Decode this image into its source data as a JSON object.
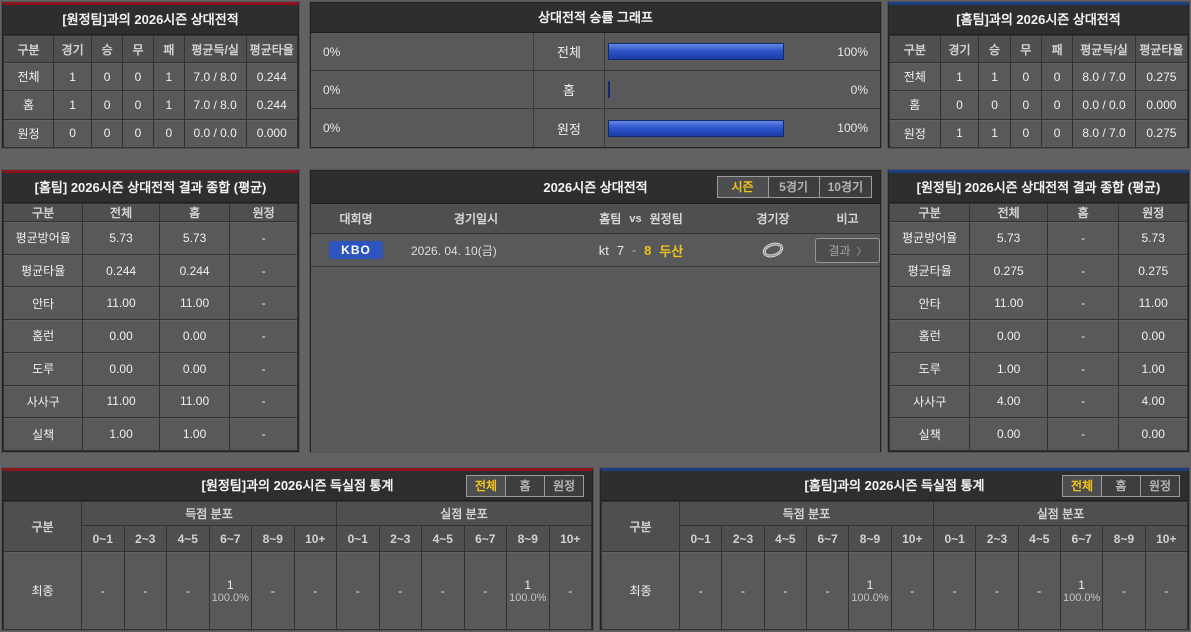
{
  "colors": {
    "accent_red": "#8d141f",
    "accent_blue": "#1c3e7e",
    "highlight_yellow": "#f0c419",
    "badge_blue": "#2d55bd",
    "bar_blue": "#2f55cc"
  },
  "top_left": {
    "title": "[원정팀]과의 2026시즌 상대전적",
    "headers": [
      "구분",
      "경기",
      "승",
      "무",
      "패",
      "평균득/실",
      "평균타율"
    ],
    "rows": [
      {
        "label": "전체",
        "values": [
          "1",
          "0",
          "0",
          "1",
          "7.0 / 8.0",
          "0.244"
        ]
      },
      {
        "label": "홈",
        "values": [
          "1",
          "0",
          "0",
          "1",
          "7.0 / 8.0",
          "0.244"
        ]
      },
      {
        "label": "원정",
        "values": [
          "0",
          "0",
          "0",
          "0",
          "0.0 / 0.0",
          "0.000"
        ]
      }
    ]
  },
  "graph": {
    "title": "상대전적 승률 그래프",
    "chart_data": {
      "type": "bar",
      "categories": [
        "전체",
        "홈",
        "원정"
      ],
      "series": [
        {
          "name": "left_win_rate",
          "values": [
            0,
            0,
            0
          ]
        },
        {
          "name": "right_win_rate",
          "values": [
            100,
            0,
            100
          ]
        }
      ],
      "xlim": [
        0,
        100
      ],
      "legend_position": "none"
    },
    "rows": [
      {
        "label": "전체",
        "left_pct": "0%",
        "right_pct": "100%",
        "left_val": 0,
        "right_val": 100
      },
      {
        "label": "홈",
        "left_pct": "0%",
        "right_pct": "0%",
        "left_val": 0,
        "right_val": 0
      },
      {
        "label": "원정",
        "left_pct": "0%",
        "right_pct": "100%",
        "left_val": 0,
        "right_val": 100
      }
    ]
  },
  "top_right": {
    "title": "[홈팀]과의 2026시즌 상대전적",
    "headers": [
      "구분",
      "경기",
      "승",
      "무",
      "패",
      "평균득/실",
      "평균타율"
    ],
    "rows": [
      {
        "label": "전체",
        "values": [
          "1",
          "1",
          "0",
          "0",
          "8.0 / 7.0",
          "0.275"
        ]
      },
      {
        "label": "홈",
        "values": [
          "0",
          "0",
          "0",
          "0",
          "0.0 / 0.0",
          "0.000"
        ]
      },
      {
        "label": "원정",
        "values": [
          "1",
          "1",
          "0",
          "0",
          "8.0 / 7.0",
          "0.275"
        ]
      }
    ]
  },
  "mid_left": {
    "title": "[홈팀] 2026시즌 상대전적 결과 종합 (평균)",
    "headers": [
      "구분",
      "전체",
      "홈",
      "원정"
    ],
    "rows": [
      {
        "label": "평균방어율",
        "values": [
          "5.73",
          "5.73",
          "-"
        ]
      },
      {
        "label": "평균타율",
        "values": [
          "0.244",
          "0.244",
          "-"
        ]
      },
      {
        "label": "안타",
        "values": [
          "11.00",
          "11.00",
          "-"
        ]
      },
      {
        "label": "홈런",
        "values": [
          "0.00",
          "0.00",
          "-"
        ]
      },
      {
        "label": "도루",
        "values": [
          "0.00",
          "0.00",
          "-"
        ]
      },
      {
        "label": "사사구",
        "values": [
          "11.00",
          "11.00",
          "-"
        ]
      },
      {
        "label": "실책",
        "values": [
          "1.00",
          "1.00",
          "-"
        ]
      }
    ]
  },
  "match": {
    "title": "2026시즌 상대전적",
    "tabs": [
      {
        "label": "시즌",
        "active": true
      },
      {
        "label": "5경기",
        "active": false
      },
      {
        "label": "10경기",
        "active": false
      }
    ],
    "headers": {
      "league": "대회명",
      "datetime": "경기일시",
      "home": "홈팀",
      "vs": "vs",
      "away": "원정팀",
      "stadium": "경기장",
      "note": "비고"
    },
    "row": {
      "league": "KBO",
      "datetime": "2026. 04. 10(금)",
      "home_team": "kt",
      "home_score": "7",
      "separator": "-",
      "away_score": "8",
      "away_team": "두산",
      "result_label": "결과",
      "result_arrow": "〉"
    }
  },
  "mid_right": {
    "title": "[원정팀] 2026시즌 상대전적 결과 종합 (평균)",
    "headers": [
      "구분",
      "전체",
      "홈",
      "원정"
    ],
    "rows": [
      {
        "label": "평균방어율",
        "values": [
          "5.73",
          "-",
          "5.73"
        ]
      },
      {
        "label": "평균타율",
        "values": [
          "0.275",
          "-",
          "0.275"
        ]
      },
      {
        "label": "안타",
        "values": [
          "11.00",
          "-",
          "11.00"
        ]
      },
      {
        "label": "홈런",
        "values": [
          "0.00",
          "-",
          "0.00"
        ]
      },
      {
        "label": "도루",
        "values": [
          "1.00",
          "-",
          "1.00"
        ]
      },
      {
        "label": "사사구",
        "values": [
          "4.00",
          "-",
          "4.00"
        ]
      },
      {
        "label": "실책",
        "values": [
          "0.00",
          "-",
          "0.00"
        ]
      }
    ]
  },
  "bottom_left": {
    "title": "[원정팀]과의 2026시즌 득실점 통계",
    "tabs": [
      {
        "label": "전체",
        "active": true
      },
      {
        "label": "홈",
        "active": false
      },
      {
        "label": "원정",
        "active": false
      }
    ],
    "group_col": "구분",
    "scored_group": "득점 분포",
    "conceded_group": "실점 분포",
    "bins": [
      "0~1",
      "2~3",
      "4~5",
      "6~7",
      "8~9",
      "10+"
    ],
    "row_label": "최종",
    "scored": [
      {
        "count": "-",
        "pct": ""
      },
      {
        "count": "-",
        "pct": ""
      },
      {
        "count": "-",
        "pct": ""
      },
      {
        "count": "1",
        "pct": "100.0%"
      },
      {
        "count": "-",
        "pct": ""
      },
      {
        "count": "-",
        "pct": ""
      }
    ],
    "conceded": [
      {
        "count": "-",
        "pct": ""
      },
      {
        "count": "-",
        "pct": ""
      },
      {
        "count": "-",
        "pct": ""
      },
      {
        "count": "-",
        "pct": ""
      },
      {
        "count": "1",
        "pct": "100.0%"
      },
      {
        "count": "-",
        "pct": ""
      }
    ]
  },
  "bottom_right": {
    "title": "[홈팀]과의 2026시즌 득실점 통계",
    "tabs": [
      {
        "label": "전체",
        "active": true
      },
      {
        "label": "홈",
        "active": false
      },
      {
        "label": "원정",
        "active": false
      }
    ],
    "group_col": "구분",
    "scored_group": "득점 분포",
    "conceded_group": "실점 분포",
    "bins": [
      "0~1",
      "2~3",
      "4~5",
      "6~7",
      "8~9",
      "10+"
    ],
    "row_label": "최종",
    "scored": [
      {
        "count": "-",
        "pct": ""
      },
      {
        "count": "-",
        "pct": ""
      },
      {
        "count": "-",
        "pct": ""
      },
      {
        "count": "-",
        "pct": ""
      },
      {
        "count": "1",
        "pct": "100.0%"
      },
      {
        "count": "-",
        "pct": ""
      }
    ],
    "conceded": [
      {
        "count": "-",
        "pct": ""
      },
      {
        "count": "-",
        "pct": ""
      },
      {
        "count": "-",
        "pct": ""
      },
      {
        "count": "1",
        "pct": "100.0%"
      },
      {
        "count": "-",
        "pct": ""
      },
      {
        "count": "-",
        "pct": ""
      }
    ]
  }
}
